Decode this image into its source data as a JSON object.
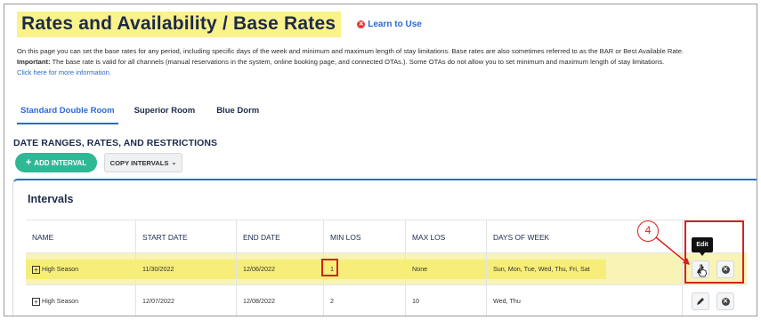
{
  "page": {
    "title": "Rates and Availability / Base Rates",
    "learn_label": "Learn to Use"
  },
  "description": {
    "line1": "On this page you can set the base rates for any period, including specific days of the week and minimum and maximum length of stay limitations. Base rates are also sometimes referred to as the BAR or Best Available Rate.",
    "important_label": "Important:",
    "line2": " The base rate is valid for all channels (manual reservations in the system, online booking page, and connected OTAs.). Some OTAs do not allow you to set minimum and maximum length of stay limitations.",
    "more_link": "Click here for more information."
  },
  "tabs": [
    {
      "label": "Standard Double Room",
      "active": true
    },
    {
      "label": "Superior Room",
      "active": false
    },
    {
      "label": "Blue Dorm",
      "active": false
    }
  ],
  "section": {
    "title": "DATE RANGES, RATES, AND RESTRICTIONS",
    "add_interval_label": "ADD INTERVAL",
    "copy_intervals_label": "COPY INTERVALS"
  },
  "intervals": {
    "title": "Intervals",
    "columns": [
      "NAME",
      "START DATE",
      "END DATE",
      "MIN LOS",
      "MAX LOS",
      "DAYS OF WEEK"
    ],
    "rows": [
      {
        "name": "High Season",
        "start": "11/30/2022",
        "end": "12/06/2022",
        "min_los": "1",
        "max_los": "None",
        "days": "Sun, Mon, Tue, Wed, Thu, Fri, Sat",
        "highlighted": true
      },
      {
        "name": "High Season",
        "start": "12/07/2022",
        "end": "12/08/2022",
        "min_los": "2",
        "max_los": "10",
        "days": "Wed, Thu",
        "highlighted": false
      }
    ]
  },
  "annotation": {
    "step_number": "4",
    "tooltip": "Edit"
  },
  "colors": {
    "accent_blue": "#2a6ad6",
    "add_green": "#2fb896",
    "highlight_yellow": "#faf28a",
    "annotation_red": "#d62020"
  },
  "icons": {
    "edit": "pencil-icon",
    "delete": "x-circle-icon",
    "expand": "plus-square-icon",
    "learn": "x-circle-icon"
  }
}
